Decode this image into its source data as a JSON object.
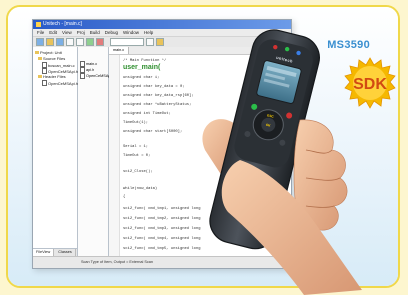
{
  "model": "MS3590",
  "sdk_badge": "SDK",
  "ide": {
    "title": "Unitech - [main.c]",
    "menu": [
      "File",
      "Edit",
      "View",
      "Proj",
      "Build",
      "Debug",
      "Window",
      "Help"
    ],
    "project_tree": [
      "Project: Unit",
      "Source Files",
      "bcscan_main.c",
      "OpenCeMSApi.h",
      "Header Files",
      "OpenCeMSApi.h"
    ],
    "file_list": [
      "main.c",
      "api.h",
      "OpenCeMSApi.h"
    ],
    "editor_tab": "main.c",
    "code_title": "user_main(",
    "code_lines": [
      "/* Main Function */",
      "unsigned char i;",
      "unsigned char key_data = 0;",
      "unsigned char key_data_rsp[60];",
      "unsigned char *uBatteryStatus;",
      "unsigned int TimeOut;",
      "TimeOut(1);",
      "unsigned char start[5000];",
      "Serial = 1;",
      "TimeOut = 0;",
      "sci2_Close();",
      "while(now_data)",
      "{",
      "  sci2_func( cmd_tmp1, unsigned long",
      "  sci2_func( cmd_tmp2, unsigned long",
      "  sci2_func( cmd_tmp3, unsigned long",
      "  sci2_func( cmd_tmp4, unsigned long",
      "  sci2_func( cmd_tmp5, unsigned long"
    ],
    "pane_tabs": [
      "FileView",
      "Classes"
    ],
    "status": "Scan Type of Item, Output = External Scan"
  },
  "device": {
    "brand": "unitech",
    "keys": [
      "OK",
      "ESC"
    ]
  },
  "colors": {
    "border": "#f0d84a",
    "accent": "#3a8fd0",
    "badge": "#f5b800",
    "device_body": "#3a3f46"
  }
}
